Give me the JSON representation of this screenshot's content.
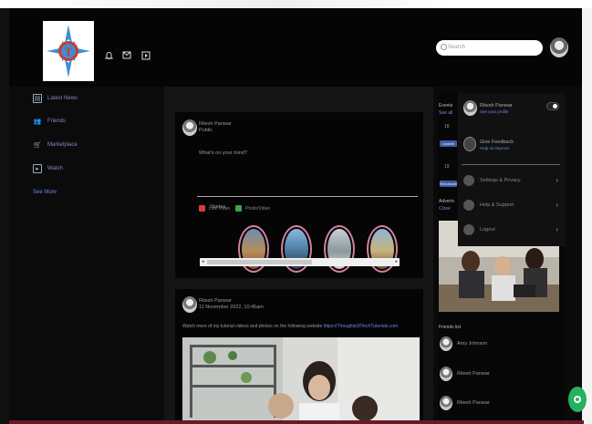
{
  "header": {
    "logo_letter": "T",
    "search_placeholder": "Search",
    "icons": [
      "bell-icon",
      "mail-icon",
      "play-icon"
    ]
  },
  "sidebar": {
    "items": [
      {
        "label": "Latest News",
        "icon": "news-icon"
      },
      {
        "label": "Friends",
        "icon": "friends-icon"
      },
      {
        "label": "Marketplace",
        "icon": "cart-icon"
      },
      {
        "label": "Watch",
        "icon": "watch-icon"
      }
    ],
    "see_more": "See More"
  },
  "composer": {
    "author": "Ritesh Panwar",
    "subtitle": "Public",
    "prompt": "What's on your mind?",
    "live_label": "Live Video",
    "photo_label": "Photo/Video",
    "stories_label": "Stories"
  },
  "post": {
    "author": "Ritesh Panwar",
    "date": "11 November 2022, 10:45am",
    "text": "Watch more of my tutorial videos and photos on the following website ",
    "link": "https://ThoughtsOfTechTutorials.com"
  },
  "right_panel": {
    "events_title": "Events",
    "events_link": "See all",
    "event_day_1": "18",
    "event_pill_1": "Update",
    "event_day_2": "19",
    "event_pill_2": "Remainder",
    "adverts_title": "Adverts",
    "adverts_link": "Close",
    "friends_list_title": "Friends list",
    "friends": [
      "Amy Johnson",
      "Ritesh Panwar",
      "Ritesh Panwar"
    ]
  },
  "dropdown": {
    "profile_name": "Ritesh Panwar",
    "profile_link": "See your profile",
    "feedback_title": "Give Feedback",
    "feedback_sub": "Help us improve",
    "items": [
      {
        "label": "Settings & Privacy",
        "icon": "gear-icon"
      },
      {
        "label": "Help & Support",
        "icon": "help-icon"
      },
      {
        "label": "Logout",
        "icon": "logout-icon"
      }
    ]
  }
}
